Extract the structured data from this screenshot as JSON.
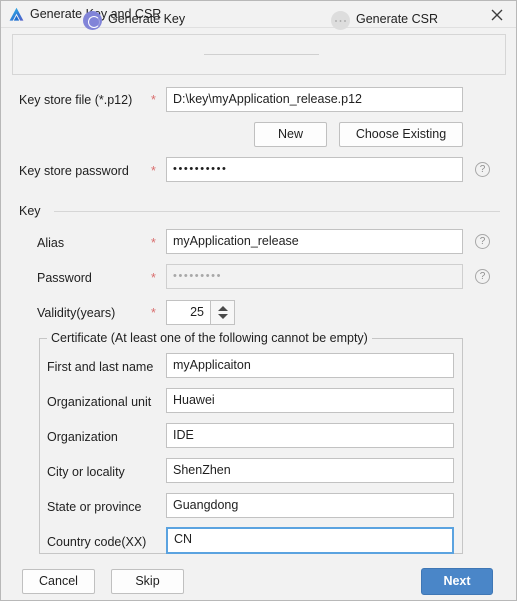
{
  "window": {
    "title": "Generate Key and CSR",
    "logo_icon": "deveco-logo-icon",
    "close_icon": "close-icon"
  },
  "steps": [
    {
      "label": "Generate Key",
      "state": "active"
    },
    {
      "label": "Generate CSR",
      "state": "inactive"
    }
  ],
  "fields": {
    "key_store_file": {
      "label": "Key store file (*.p12)",
      "required_marker": "*",
      "value": "D:\\key\\myApplication_release.p12"
    },
    "key_store_password": {
      "label": "Key store password",
      "required_marker": "*",
      "value": "••••••••••",
      "help_icon": "help-icon"
    },
    "alias": {
      "label": "Alias",
      "required_marker": "*",
      "value": "myApplication_release",
      "help_icon": "help-icon"
    },
    "password": {
      "label": "Password",
      "required_marker": "*",
      "value": "•••••••••",
      "help_icon": "help-icon"
    },
    "validity": {
      "label": "Validity(years)",
      "required_marker": "*",
      "value": "25",
      "spinner_up_icon": "spinner-up-icon",
      "spinner_down_icon": "spinner-down-icon"
    }
  },
  "key_group": {
    "label": "Key"
  },
  "certificate": {
    "legend": "Certificate (At least one of the following cannot be empty)",
    "rows": [
      {
        "label": "First and last name",
        "value": "myApplicaiton"
      },
      {
        "label": "Organizational unit",
        "value": "Huawei"
      },
      {
        "label": "Organization",
        "value": "IDE"
      },
      {
        "label": "City or locality",
        "value": "ShenZhen"
      },
      {
        "label": "State or province",
        "value": "Guangdong"
      },
      {
        "label": "Country code(XX)",
        "value": "CN"
      }
    ]
  },
  "buttons": {
    "new": "New",
    "choose_existing": "Choose Existing",
    "cancel": "Cancel",
    "skip": "Skip",
    "next": "Next"
  },
  "colors": {
    "dialog_bg": "#f2f2f2",
    "primary_button": "#4a86c8",
    "active_step": "#8184d8",
    "required_asterisk": "#d96d6d",
    "focus_border": "#5ba3e0"
  }
}
